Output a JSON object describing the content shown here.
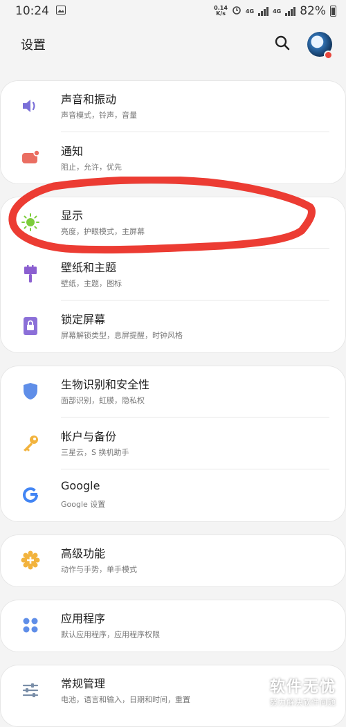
{
  "status_bar": {
    "time": "10:24",
    "net_speed_value": "0.14",
    "net_speed_unit": "K/s",
    "network_type": "4G",
    "network_type_2": "4G",
    "battery": "82%"
  },
  "header": {
    "title": "设置"
  },
  "settings": [
    {
      "title": "声音和振动",
      "subtitle": "声音模式，铃声，音量",
      "icon": "volume-icon",
      "color": "#7a6fd8"
    },
    {
      "title": "通知",
      "subtitle": "阻止，允许，优先",
      "icon": "notification-icon",
      "color": "#ea6e62"
    },
    {
      "title": "显示",
      "subtitle": "亮度，护眼模式，主屏幕",
      "icon": "brightness-icon",
      "color": "#7ccc3a"
    },
    {
      "title": "壁纸和主题",
      "subtitle": "壁纸，主题，图标",
      "icon": "paintbrush-icon",
      "color": "#8b5fd0"
    },
    {
      "title": "锁定屏幕",
      "subtitle": "屏幕解锁类型，息屏提醒，时钟风格",
      "icon": "lock-icon",
      "color": "#8b6fd8"
    },
    {
      "title": "生物识别和安全性",
      "subtitle": "面部识别，虹膜，隐私权",
      "icon": "shield-icon",
      "color": "#5f8ee8"
    },
    {
      "title": "帐户与备份",
      "subtitle": "三星云，S 换机助手",
      "icon": "key-icon",
      "color": "#f2b33d"
    },
    {
      "title": "Google",
      "subtitle": "Google 设置",
      "icon": "google-icon",
      "color": "#4285f4"
    },
    {
      "title": "高级功能",
      "subtitle": "动作与手势，单手模式",
      "icon": "plus-gear-icon",
      "color": "#f2b33d"
    },
    {
      "title": "应用程序",
      "subtitle": "默认应用程序，应用程序权限",
      "icon": "apps-grid-icon",
      "color": "#5f8ee8"
    },
    {
      "title": "常规管理",
      "subtitle": "电池，语言和输入，日期和时间，重置",
      "icon": "sliders-icon",
      "color": "#7a8ea8"
    }
  ],
  "watermark": {
    "title": "软件无忧",
    "subtitle": "努力解决软件问题"
  }
}
